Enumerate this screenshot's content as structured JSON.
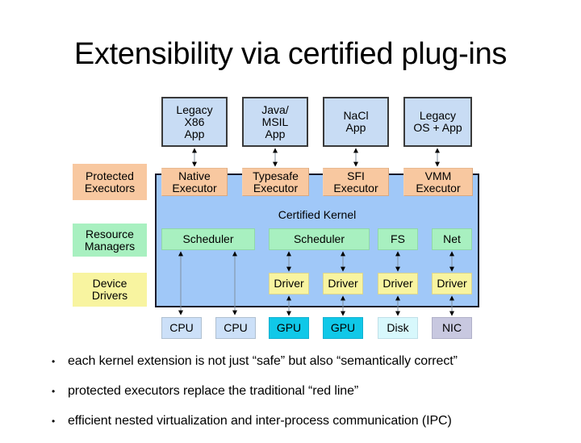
{
  "title": "Extensibility via certified plug-ins",
  "diagram": {
    "legend": {
      "protected_executors": "Protected\nExecutors",
      "resource_managers": "Resource\nManagers",
      "device_drivers": "Device\nDrivers"
    },
    "apps": [
      "Legacy\nX86\nApp",
      "Java/\nMSIL\nApp",
      "NaCl\nApp",
      "Legacy\nOS + App"
    ],
    "executors": [
      "Native\nExecutor",
      "Typesafe\nExecutor",
      "SFI\nExecutor",
      "VMM\nExecutor"
    ],
    "kernel_label": "Certified Kernel",
    "resource_managers": [
      "Scheduler",
      "Scheduler",
      "FS",
      "Net"
    ],
    "drivers": [
      "Driver",
      "Driver",
      "Driver",
      "Driver"
    ],
    "hardware": [
      "CPU",
      "CPU",
      "GPU",
      "GPU",
      "Disk",
      "NIC"
    ],
    "colors": {
      "app": "#c8dcf4",
      "executor": "#f8c8a0",
      "kernel": "#a0c8f8",
      "resource_manager": "#a8f0c0",
      "driver": "#f8f4a0",
      "cpu": "#cce0f8",
      "gpu": "#10c8e8",
      "disk": "#d8f8fc",
      "nic": "#c8c8e0"
    }
  },
  "bullets": [
    "each kernel extension is not just “safe” but also “semantically correct”",
    "protected executors replace the traditional “red line”",
    "efficient nested virtualization and inter-process communication (IPC)"
  ],
  "bullet_glyph": "•"
}
